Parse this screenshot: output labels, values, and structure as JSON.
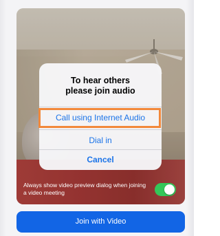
{
  "dialog": {
    "title_line1": "To hear others",
    "title_line2": "please join audio",
    "option_internet_audio": "Call using Internet Audio",
    "option_dial_in": "Dial in",
    "option_cancel": "Cancel"
  },
  "preview": {
    "toggle_label": "Always show video preview dialog when joining a video meeting",
    "toggle_on": true
  },
  "footer": {
    "join_button_label": "Join with Video"
  },
  "colors": {
    "accent_blue": "#1265e5",
    "link_blue": "#1a73e8",
    "highlight_orange": "#f2883a",
    "toggle_green": "#34c759"
  }
}
